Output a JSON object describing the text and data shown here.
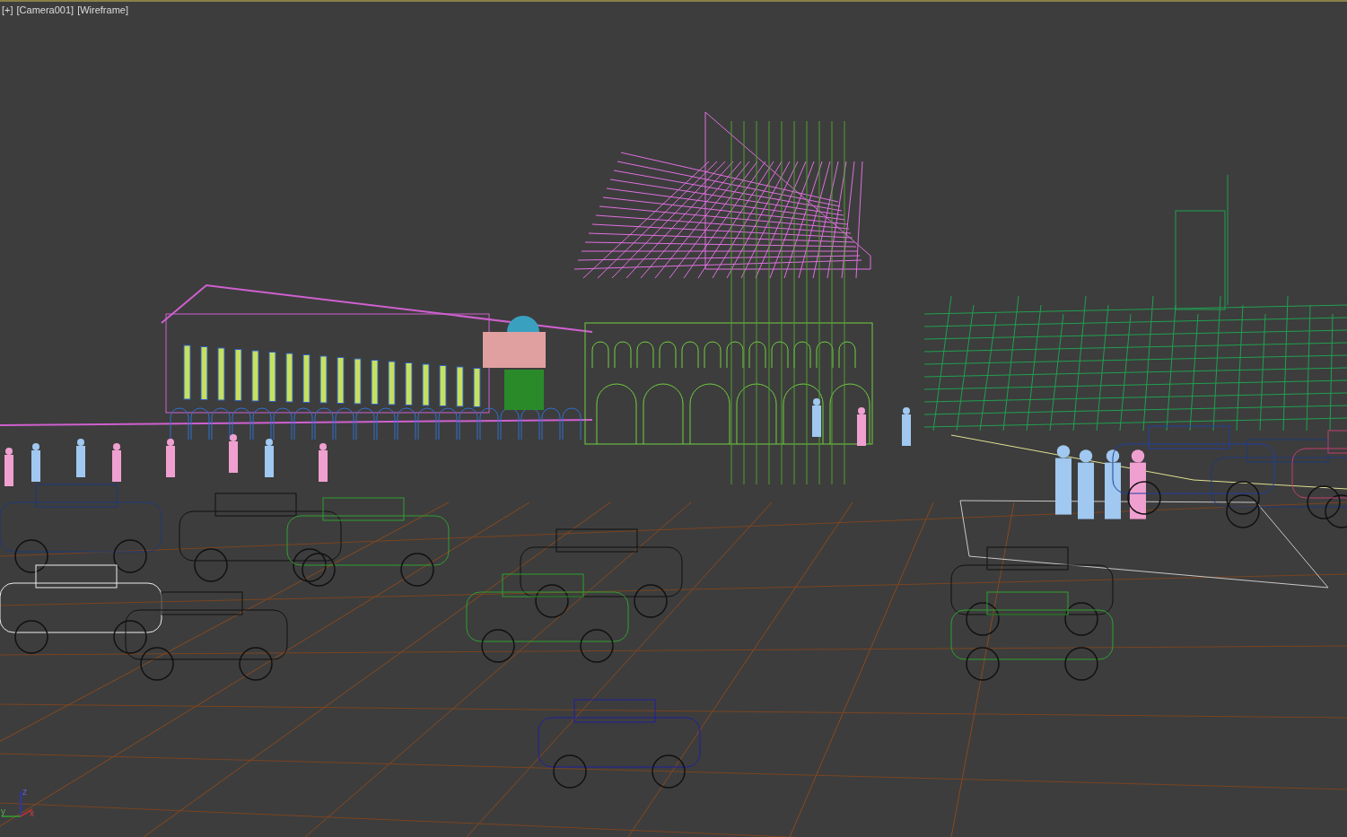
{
  "viewport": {
    "menus": [
      {
        "label": "[+]"
      },
      {
        "label": "[Camera001]"
      },
      {
        "label": "[Wireframe]"
      }
    ],
    "active": true,
    "axis_gizmo": {
      "z": "z",
      "y": "y",
      "x": "x"
    }
  }
}
